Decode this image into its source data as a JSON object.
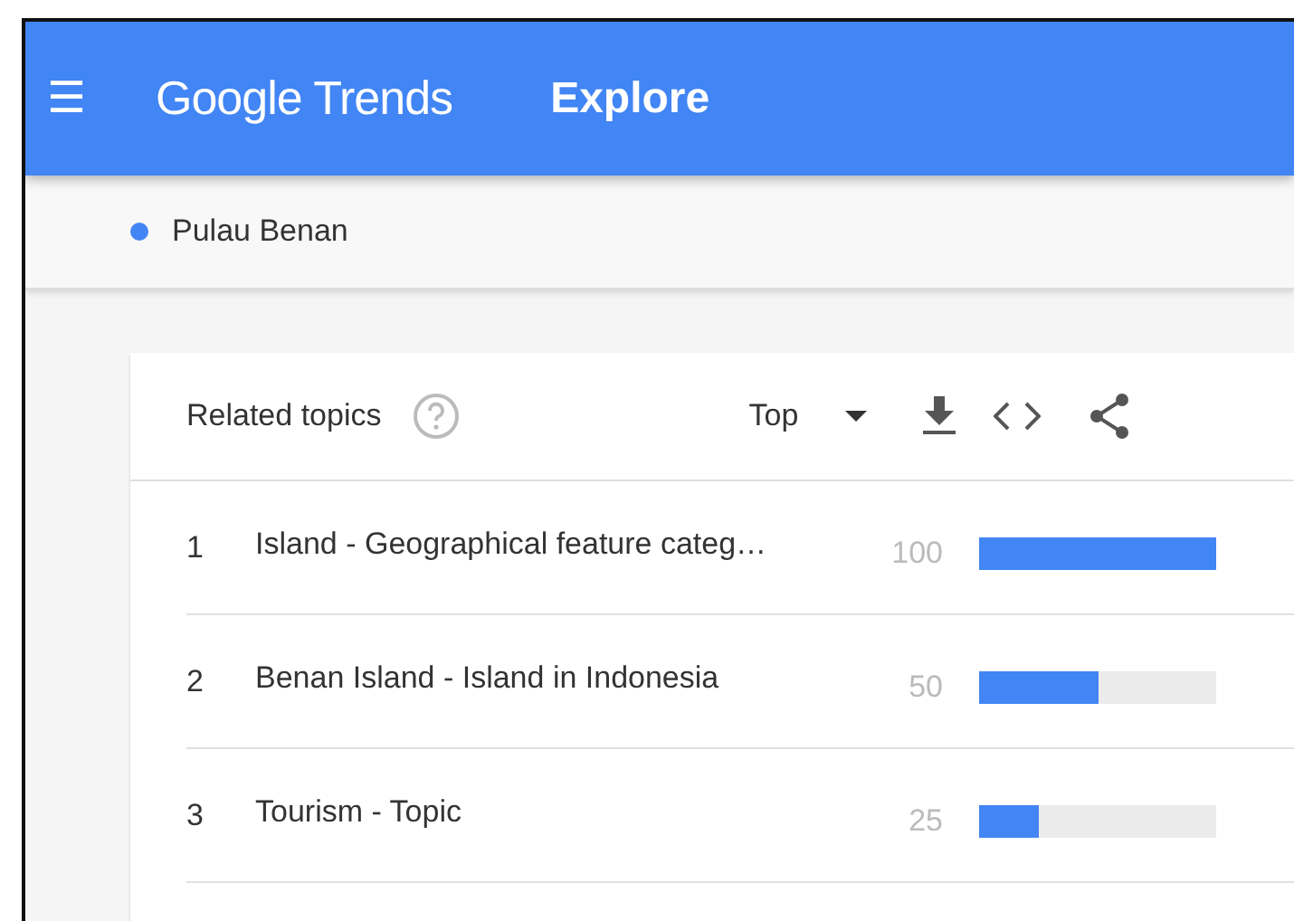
{
  "header": {
    "menu_icon": "☰",
    "logo": "Google Trends",
    "title": "Explore"
  },
  "term": {
    "label": "Pulau Benan",
    "color": "#4285f4"
  },
  "card": {
    "title": "Related topics",
    "filter": "Top",
    "rows": [
      {
        "rank": "1",
        "topic": "Island - Geographical feature categ…",
        "value": "100",
        "level": 1.0
      },
      {
        "rank": "2",
        "topic": "Benan Island - Island in Indonesia",
        "value": "50",
        "level": 0.5
      },
      {
        "rank": "3",
        "topic": "Tourism - Topic",
        "value": "25",
        "level": 0.25
      }
    ]
  }
}
